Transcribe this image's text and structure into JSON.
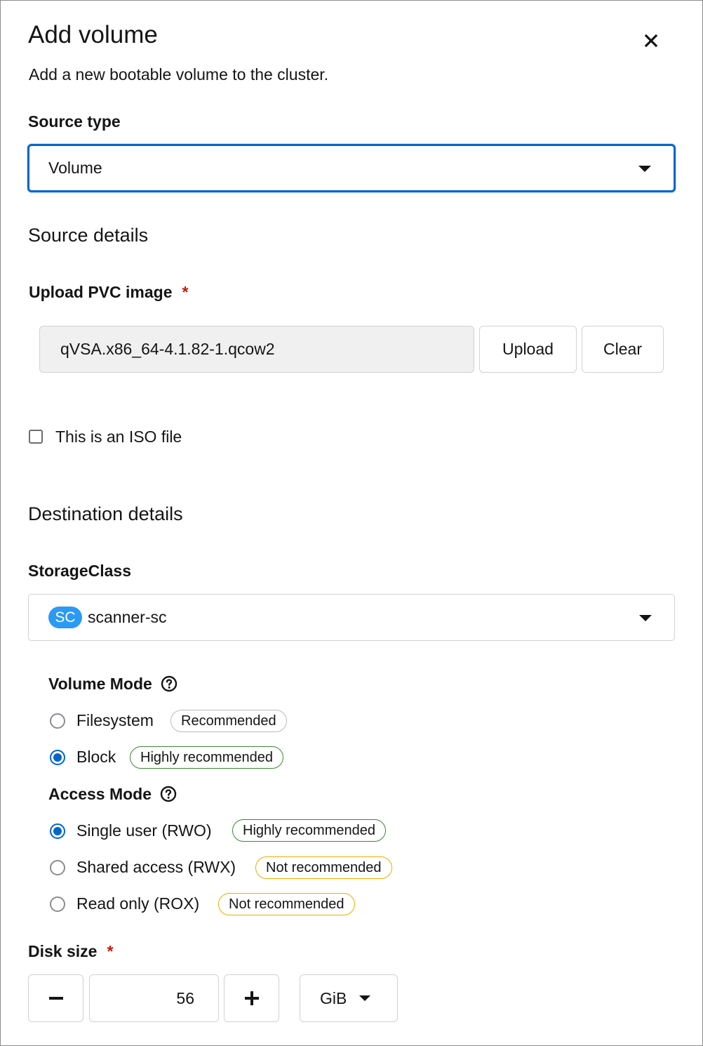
{
  "modal": {
    "title": "Add volume",
    "subtitle": "Add a new bootable volume to the cluster."
  },
  "source_type": {
    "label": "Source type",
    "value": "Volume"
  },
  "source_details": {
    "heading": "Source details",
    "upload_label": "Upload PVC image",
    "required_mark": "*",
    "filename": "qVSA.x86_64-4.1.82-1.qcow2",
    "upload_button": "Upload",
    "clear_button": "Clear",
    "iso_checkbox_label": "This is an ISO file",
    "iso_checked": false
  },
  "destination_details": {
    "heading": "Destination details",
    "storage_class_label": "StorageClass",
    "storage_class_badge": "SC",
    "storage_class_value": "scanner-sc"
  },
  "volume_mode": {
    "label": "Volume Mode",
    "options": [
      {
        "label": "Filesystem",
        "tag": "Recommended",
        "checked": false
      },
      {
        "label": "Block",
        "tag": "Highly recommended",
        "checked": true
      }
    ]
  },
  "access_mode": {
    "label": "Access Mode",
    "options": [
      {
        "label": "Single user (RWO)",
        "tag": "Highly recommended",
        "checked": true
      },
      {
        "label": "Shared access (RWX)",
        "tag": "Not recommended",
        "checked": false
      },
      {
        "label": "Read only (ROX)",
        "tag": "Not recommended",
        "checked": false
      }
    ]
  },
  "disk_size": {
    "label": "Disk size",
    "required_mark": "*",
    "minus": "−",
    "value": "56",
    "plus": "+",
    "unit": "GiB"
  },
  "colors": {
    "accent": "#0066cc",
    "required": "#c9190b",
    "tag_green": "#3e8635",
    "tag_yellow": "#f0ab00",
    "badge_blue": "#2b9af3"
  }
}
